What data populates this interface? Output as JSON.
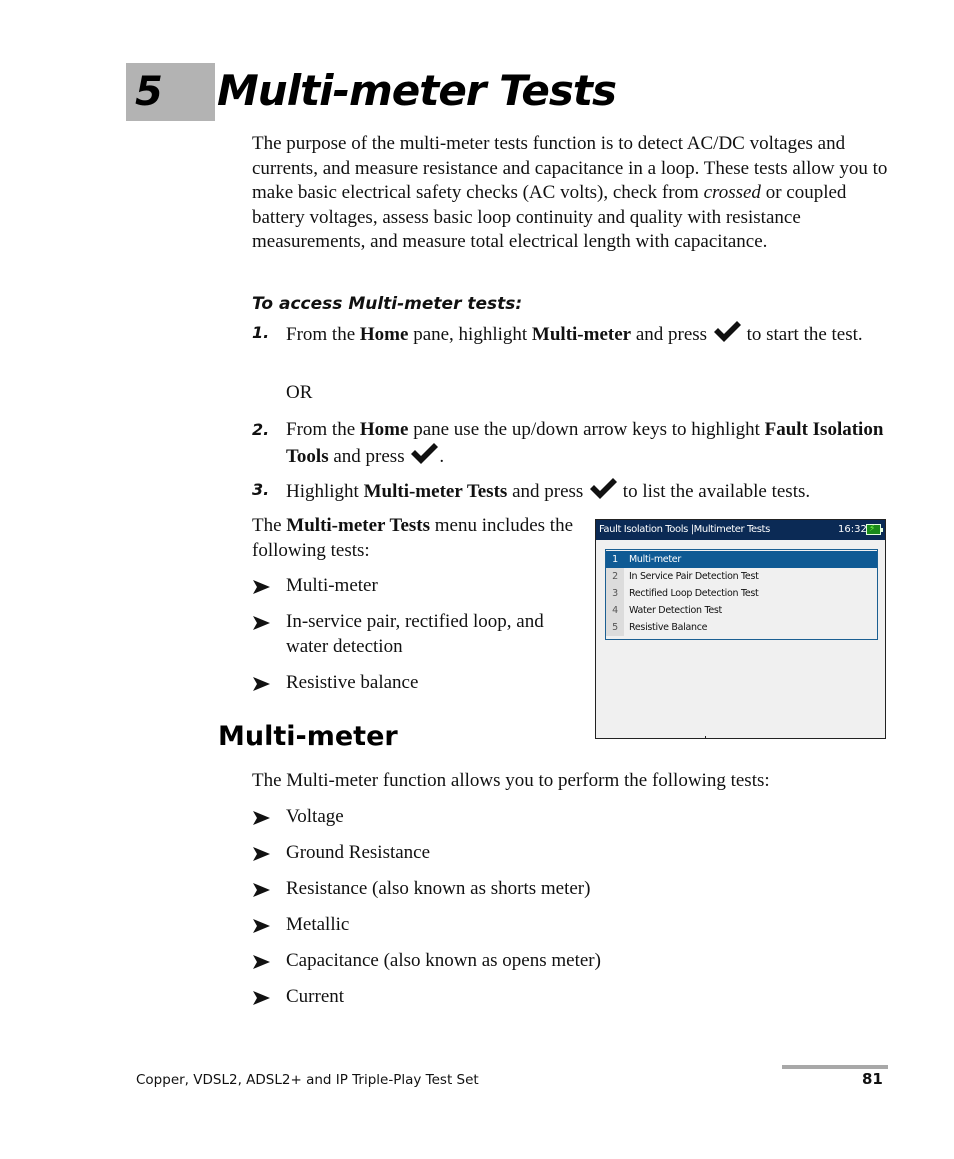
{
  "chapter": {
    "number": "5",
    "title": "Multi-meter Tests"
  },
  "intro": {
    "before_italic": "The purpose of the multi-meter tests function is to detect AC/DC voltages and currents, and measure resistance and capacitance in a loop. These tests allow you to make basic electrical safety checks (AC volts), check from ",
    "italic": "crossed",
    "after_italic": " or coupled battery voltages, assess basic loop continuity and quality with resistance measurements, and measure total electrical length with capacitance."
  },
  "access": {
    "heading": "To access Multi-meter tests:",
    "or_text": "OR",
    "steps": [
      {
        "num": "1.",
        "p1": "From the ",
        "b1": "Home",
        "p2": " pane, highlight ",
        "b2": "Multi-meter",
        "p3": " and press ",
        "p4": " to start the test."
      },
      {
        "num": "2.",
        "p1": "From the ",
        "b1": "Home",
        "p2": " pane use the up/down arrow keys to highlight ",
        "b2": "Fault Isolation Tools",
        "p3": " and press ",
        "p4": "."
      },
      {
        "num": "3.",
        "p1": "Highlight ",
        "b1": "Multi-meter Tests",
        "p2": " and press ",
        "p3": " to list the available tests."
      }
    ],
    "check_icon": "checkmark-key-icon"
  },
  "menu_intro": {
    "p1": "The ",
    "bold": "Multi-meter Tests",
    "p2": " menu includes the following tests:",
    "bullets": [
      "Multi-meter",
      "In-service pair, rectified loop, and water detection",
      "Resistive balance"
    ]
  },
  "screenshot": {
    "title": "Fault Isolation Tools |Multimeter Tests",
    "time": "16:32",
    "battery_icon": "battery-charging-icon",
    "items": [
      {
        "num": "1",
        "label": "Multi-meter",
        "selected": true
      },
      {
        "num": "2",
        "label": "In Service Pair Detection Test",
        "selected": false
      },
      {
        "num": "3",
        "label": "Rectified Loop Detection Test",
        "selected": false
      },
      {
        "num": "4",
        "label": "Water Detection Test",
        "selected": false
      },
      {
        "num": "5",
        "label": "Resistive Balance",
        "selected": false
      }
    ],
    "colors": {
      "titlebar": "#0b2a55",
      "selected": "#0f5a94",
      "list_border": "#1b5f92",
      "background": "#f0f0f0"
    }
  },
  "multimeter_section": {
    "title": "Multi-meter",
    "intro": "The Multi-meter function allows you to perform the following tests:",
    "bullets": [
      "Voltage",
      "Ground Resistance",
      "Resistance (also known as shorts meter)",
      "Metallic",
      "Capacitance (also known as opens meter)",
      "Current"
    ]
  },
  "footer": {
    "text": "Copper, VDSL2, ADSL2+ and IP Triple-Play Test Set",
    "page": "81"
  }
}
